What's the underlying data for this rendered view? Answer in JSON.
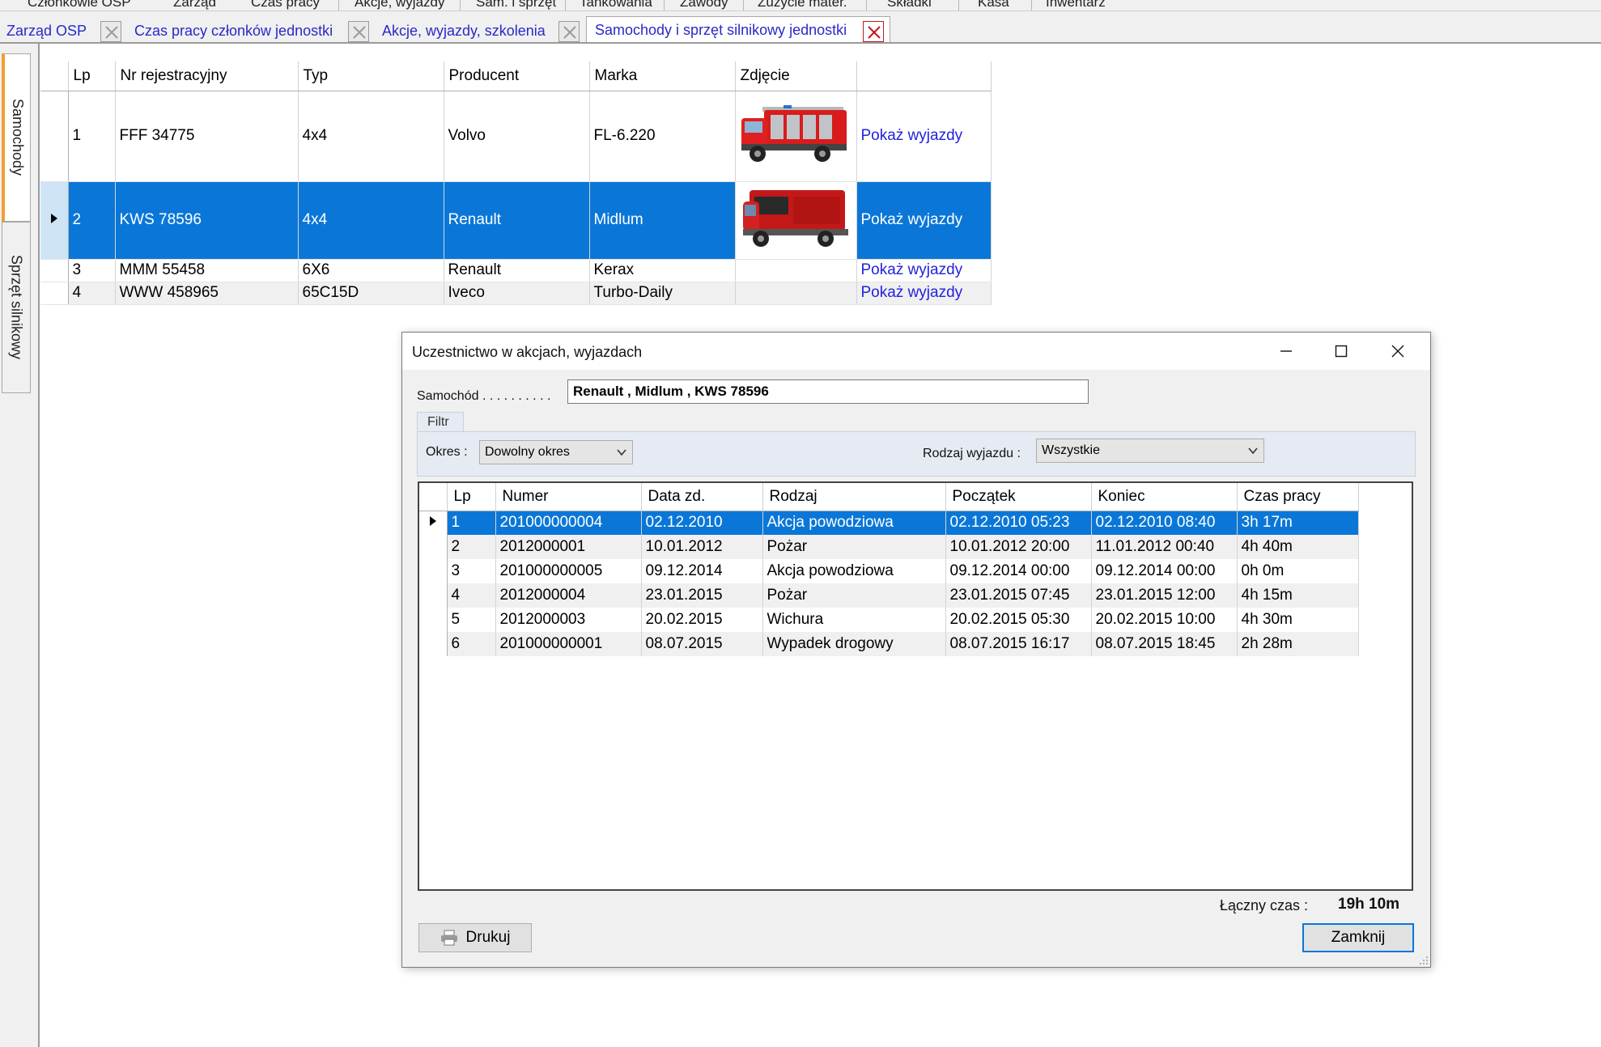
{
  "menu": {
    "items": [
      "Członkowie OSP",
      "Zarząd",
      "Czas pracy",
      "Akcje, wyjazdy",
      "Sam. i sprzęt",
      "Tankowania",
      "Zawody",
      "Zużycie mater.",
      "Składki",
      "Kasa",
      "Inwentarz"
    ]
  },
  "tabs": [
    {
      "label": "Zarząd OSP"
    },
    {
      "label": "Czas pracy członków jednostki"
    },
    {
      "label": "Akcje, wyjazdy, szkolenia"
    },
    {
      "label": "Samochody i sprzęt silnikowy jednostki"
    }
  ],
  "side_tabs": [
    {
      "label": "Samochody"
    },
    {
      "label": "Sprzęt silnikowy"
    }
  ],
  "vehicles": {
    "columns": [
      "Lp",
      "Nr rejestracyjny",
      "Typ",
      "Producent",
      "Marka",
      "Zdjęcie",
      ""
    ],
    "rows": [
      {
        "lp": "1",
        "nr": "FFF 34775",
        "typ": "4x4",
        "producent": "Volvo",
        "marka": "FL-6.220",
        "photo": "fire-truck-image",
        "link": "Pokaż wyjazdy"
      },
      {
        "lp": "2",
        "nr": "KWS 78596",
        "typ": "4x4",
        "producent": "Renault",
        "marka": "Midlum",
        "photo": "fire-truck-image",
        "link": "Pokaż wyjazdy"
      },
      {
        "lp": "3",
        "nr": "MMM 55458",
        "typ": "6X6",
        "producent": "Renault",
        "marka": "Kerax",
        "photo": "",
        "link": "Pokaż wyjazdy"
      },
      {
        "lp": "4",
        "nr": "WWW 458965",
        "typ": "65C15D",
        "producent": "Iveco",
        "marka": "Turbo-Daily",
        "photo": "",
        "link": "Pokaż wyjazdy"
      }
    ],
    "selected_index": 1
  },
  "dialog": {
    "title": "Uczestnictwo w akcjach, wyjazdach",
    "samochod_label": "Samochód . . . . . . . . . .",
    "samochod_value": "Renault , Midlum , KWS 78596",
    "filter_tab": "Filtr",
    "okres_label": "Okres :",
    "okres_value": "Dowolny okres",
    "rodzaj_label": "Rodzaj wyjazdu :",
    "rodzaj_value": "Wszystkie",
    "table": {
      "columns": [
        "Lp",
        "Numer",
        "Data zd.",
        "Rodzaj",
        "Początek",
        "Koniec",
        "Czas pracy"
      ],
      "rows": [
        {
          "lp": "1",
          "numer": "201000000004",
          "data": "02.12.2010",
          "rodzaj": "Akcja powodziowa",
          "poczatek": "02.12.2010 05:23",
          "koniec": "02.12.2010 08:40",
          "czas": "3h 17m"
        },
        {
          "lp": "2",
          "numer": "2012000001",
          "data": "10.01.2012",
          "rodzaj": "Pożar",
          "poczatek": "10.01.2012 20:00",
          "koniec": "11.01.2012 00:40",
          "czas": "4h 40m"
        },
        {
          "lp": "3",
          "numer": "201000000005",
          "data": "09.12.2014",
          "rodzaj": "Akcja powodziowa",
          "poczatek": "09.12.2014 00:00",
          "koniec": "09.12.2014 00:00",
          "czas": "0h 0m"
        },
        {
          "lp": "4",
          "numer": "2012000004",
          "data": "23.01.2015",
          "rodzaj": "Pożar",
          "poczatek": "23.01.2015 07:45",
          "koniec": "23.01.2015 12:00",
          "czas": "4h 15m"
        },
        {
          "lp": "5",
          "numer": "2012000003",
          "data": "20.02.2015",
          "rodzaj": "Wichura",
          "poczatek": "20.02.2015 05:30",
          "koniec": "20.02.2015 10:00",
          "czas": "4h 30m"
        },
        {
          "lp": "6",
          "numer": "201000000001",
          "data": "08.07.2015",
          "rodzaj": "Wypadek drogowy",
          "poczatek": "08.07.2015 16:17",
          "koniec": "08.07.2015 18:45",
          "czas": "2h 28m"
        }
      ],
      "selected_index": 0
    },
    "total_label": "Łączny czas :",
    "total_value": "19h 10m",
    "print_button": "Drukuj",
    "close_button": "Zamknij"
  },
  "colors": {
    "selection": "#0a77d8",
    "link": "#2222dd",
    "tab_active_close": "#c01818",
    "side_tab_accent": "#f0a030"
  }
}
